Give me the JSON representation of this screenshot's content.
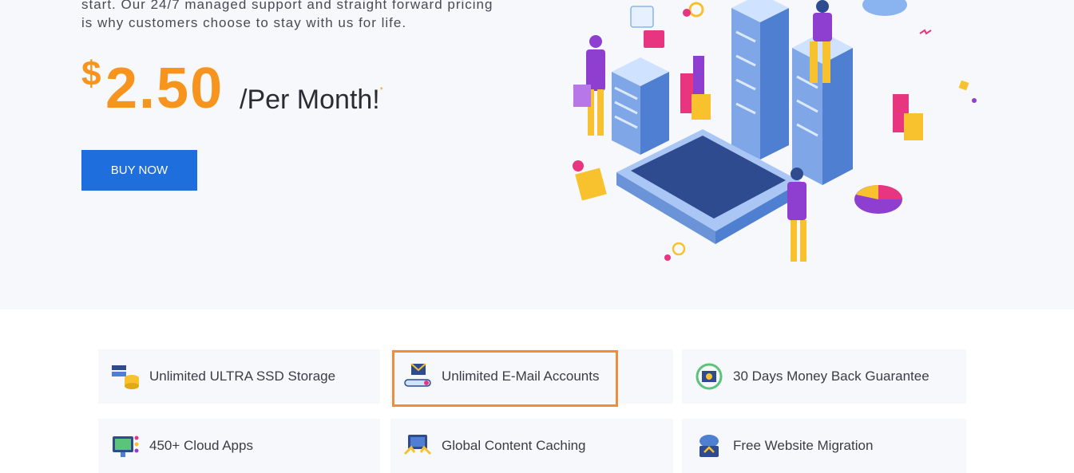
{
  "hero": {
    "intro_line1": "start. Our 24/7 managed support and straight forward pricing",
    "intro_line2": "is why customers choose to stay with us for life.",
    "currency": "$",
    "amount": "2.50",
    "period": "/Per Month!",
    "footnote_mark": "*",
    "buy_label": "BUY NOW"
  },
  "features": [
    {
      "label": "Unlimited ULTRA SSD Storage",
      "icon": "ssd-storage-icon"
    },
    {
      "label": "Unlimited E-Mail Accounts",
      "icon": "email-accounts-icon"
    },
    {
      "label": "30 Days Money Back Guarantee",
      "icon": "money-back-icon"
    },
    {
      "label": "450+ Cloud Apps",
      "icon": "cloud-apps-icon"
    },
    {
      "label": "Global Content Caching",
      "icon": "content-caching-icon"
    },
    {
      "label": "Free Website Migration",
      "icon": "website-migration-icon"
    }
  ],
  "colors": {
    "accent_orange": "#f7941d",
    "button_blue": "#1e6fdd",
    "highlight_border": "#f28c38",
    "purple": "#8e3fd0"
  }
}
